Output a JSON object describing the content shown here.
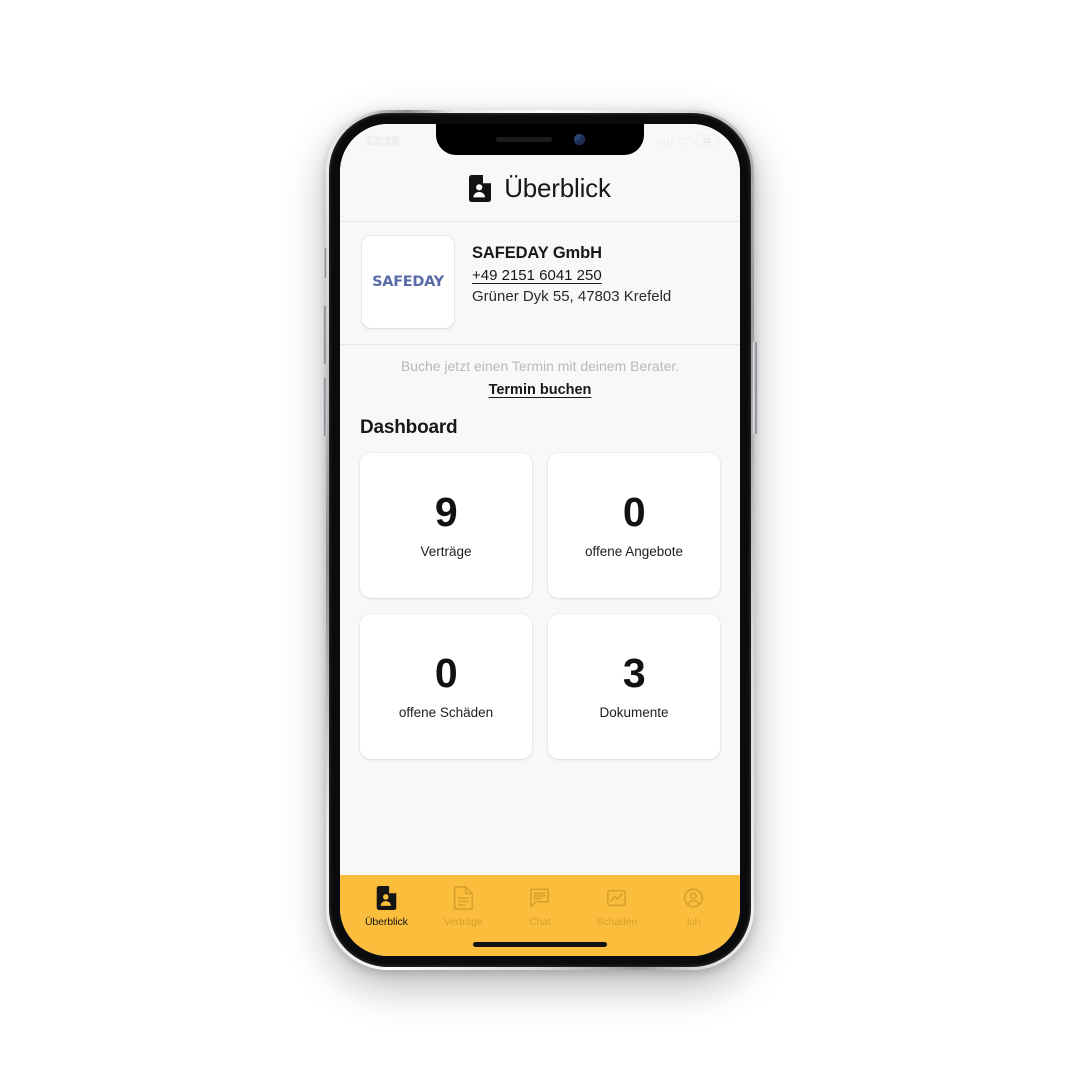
{
  "status_bar": {
    "time": "13:19",
    "battery_level": "32",
    "signal_icon": "signal-bars-icon",
    "wifi_icon": "wifi-icon",
    "battery_icon": "battery-icon"
  },
  "header": {
    "title": "Überblick",
    "icon": "document-person-icon"
  },
  "contact": {
    "logo_text": "SAFEDAY",
    "company": "SAFEDAY GmbH",
    "phone": "+49 2151 6041 250",
    "address": "Grüner Dyk 55, 47803 Krefeld"
  },
  "booking": {
    "hint": "Buche jetzt einen Termin mit deinem Berater.",
    "link": "Termin buchen"
  },
  "dashboard": {
    "title": "Dashboard",
    "cards": [
      {
        "value": "9",
        "label": "Verträge"
      },
      {
        "value": "0",
        "label": "offene Angebote"
      },
      {
        "value": "0",
        "label": "offene Schäden"
      },
      {
        "value": "3",
        "label": "Dokumente"
      }
    ]
  },
  "tabbar": {
    "background_color": "#fbbe3c",
    "active_color": "#141414",
    "inactive_color": "#d9a02d",
    "items": [
      {
        "label": "Überblick",
        "icon": "document-person-icon",
        "active": true
      },
      {
        "label": "Verträge",
        "icon": "document-lines-icon",
        "active": false
      },
      {
        "label": "Chat",
        "icon": "chat-bubble-icon",
        "active": false
      },
      {
        "label": "Schäden",
        "icon": "chart-frame-icon",
        "active": false
      },
      {
        "label": "Ich",
        "icon": "person-circle-icon",
        "active": false
      }
    ]
  }
}
